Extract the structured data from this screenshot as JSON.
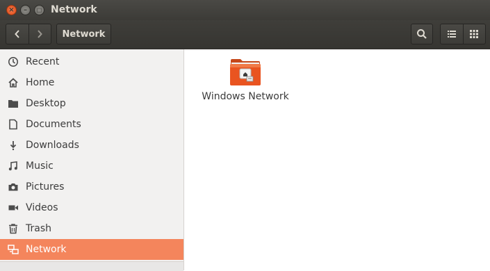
{
  "window": {
    "title": "Network",
    "close_glyph": "×",
    "min_glyph": "–",
    "max_glyph": "□"
  },
  "toolbar": {
    "back_icon": "chevron-left-icon",
    "forward_icon": "chevron-right-icon",
    "path_label": "Network",
    "search_icon": "search-icon",
    "list_view_icon": "list-view-icon",
    "grid_view_icon": "grid-view-icon"
  },
  "sidebar": {
    "items": [
      {
        "label": "Recent",
        "icon": "clock-icon"
      },
      {
        "label": "Home",
        "icon": "home-icon"
      },
      {
        "label": "Desktop",
        "icon": "desktop-folder-icon"
      },
      {
        "label": "Documents",
        "icon": "document-icon"
      },
      {
        "label": "Downloads",
        "icon": "download-icon"
      },
      {
        "label": "Music",
        "icon": "music-icon"
      },
      {
        "label": "Pictures",
        "icon": "camera-icon"
      },
      {
        "label": "Videos",
        "icon": "video-icon"
      },
      {
        "label": "Trash",
        "icon": "trash-icon"
      },
      {
        "label": "Network",
        "icon": "network-icon",
        "active": true
      }
    ]
  },
  "main": {
    "items": [
      {
        "label": "Windows Network",
        "icon": "network-folder-icon"
      }
    ]
  },
  "colors": {
    "accent": "#f4855c",
    "titlebar": "#3c3b37",
    "sidebar_bg": "#f2f1f0",
    "folder_orange": "#e95420"
  }
}
